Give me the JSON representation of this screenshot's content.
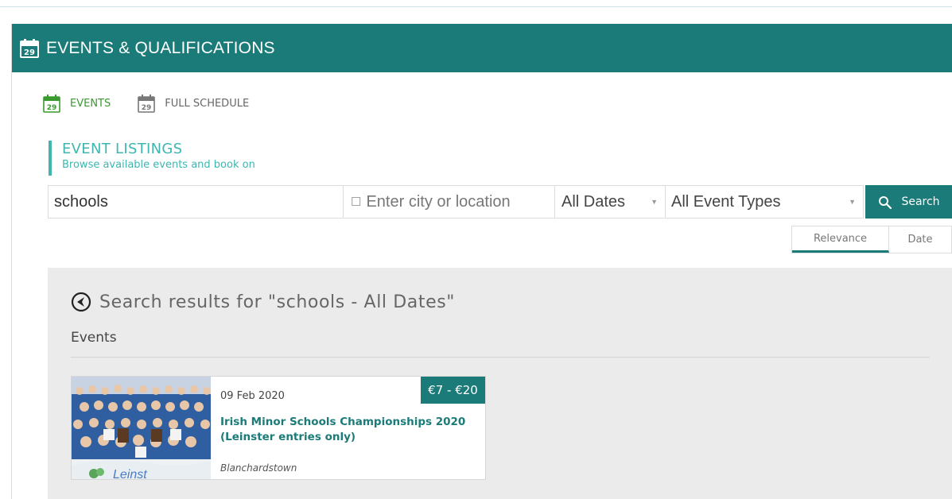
{
  "header": {
    "title": "EVENTS & QUALIFICATIONS",
    "icon": "calendar-14-icon",
    "color": "#1b7b79"
  },
  "tabs": [
    {
      "label": "EVENTS",
      "icon_number": "29",
      "active": true,
      "color": "#3a9a2f"
    },
    {
      "label": "FULL SCHEDULE",
      "icon_number": "29",
      "active": false
    }
  ],
  "listing": {
    "title": "EVENT LISTINGS",
    "subtitle": "Browse available events and book on",
    "accent": "#3fb6b0"
  },
  "search": {
    "keyword_value": "schools",
    "location_placeholder": "Enter city or location",
    "dates_selected": "All Dates",
    "types_selected": "All Event Types",
    "button_label": "Search"
  },
  "sort": {
    "options": [
      "Relevance",
      "Date"
    ],
    "active": "Relevance"
  },
  "results": {
    "heading": "Search results for \"schools - All Dates\"",
    "section_label": "Events",
    "events": [
      {
        "date": "09 Feb 2020",
        "price": "€7 - €20",
        "title": "Irish Minor Schools Championships 2020 (Leinster entries only)",
        "location": "Blanchardstown"
      }
    ]
  }
}
